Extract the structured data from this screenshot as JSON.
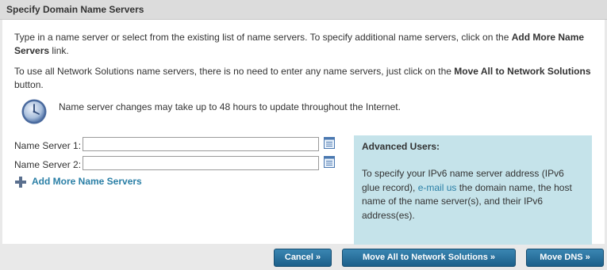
{
  "header": {
    "title": "Specify Domain Name Servers"
  },
  "intro": {
    "p1_pre": "Type in a name server or select from the existing list of name servers. To specify additional name servers, click on the ",
    "p1_bold": "Add More Name Servers",
    "p1_post": " link.",
    "p2_pre": "To use all Network Solutions name servers, there is no need to enter any name servers, just click on the ",
    "p2_bold": "Move All to Network Solutions",
    "p2_post": " button."
  },
  "note": {
    "icon": "clock-icon",
    "text": "Name server changes may take up to 48 hours to update throughout the Internet."
  },
  "name_servers": [
    {
      "label": "Name Server 1:",
      "value": ""
    },
    {
      "label": "Name Server 2:",
      "value": ""
    }
  ],
  "add_more": {
    "label": "Add More Name Servers"
  },
  "advanced": {
    "title": "Advanced Users:",
    "body_pre": "To specify your IPv6 name server address (IPv6 glue record), ",
    "link": "e-mail us",
    "body_post": " the domain name, the host name of the name server(s), and their IPv6 address(es)."
  },
  "buttons": {
    "cancel": "Cancel »",
    "move_all": "Move All to Network Solutions »",
    "move_dns": "Move DNS »"
  },
  "colors": {
    "link": "#2a7fa6",
    "button": "#1c5f8a",
    "advanced_bg": "#c5e3ea"
  }
}
